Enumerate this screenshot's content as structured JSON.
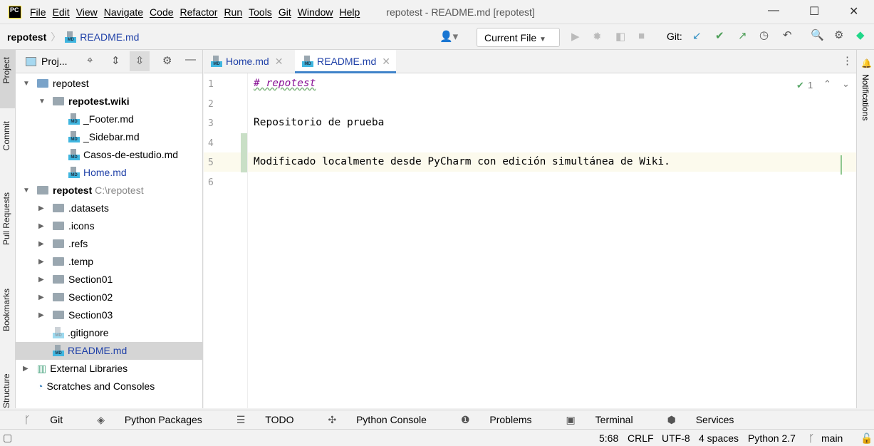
{
  "app": {
    "logo": "PC",
    "title": "repotest - README.md [repotest]"
  },
  "menu": [
    "File",
    "Edit",
    "View",
    "Navigate",
    "Code",
    "Refactor",
    "Run",
    "Tools",
    "Git",
    "Window",
    "Help"
  ],
  "breadcrumb": {
    "project": "repotest",
    "file": "README.md"
  },
  "toolbar": {
    "run_config": "Current File",
    "git_label": "Git:"
  },
  "project_panel": {
    "title": "Proj..."
  },
  "tree": [
    {
      "label": "repotest",
      "level": 0,
      "expanded": true,
      "type": "module"
    },
    {
      "label": "repotest.wiki",
      "level": 1,
      "expanded": true,
      "type": "folder",
      "bold": true
    },
    {
      "label": "_Footer.md",
      "level": 2,
      "type": "md"
    },
    {
      "label": "_Sidebar.md",
      "level": 2,
      "type": "md"
    },
    {
      "label": "Casos-de-estudio.md",
      "level": 2,
      "type": "md"
    },
    {
      "label": "Home.md",
      "level": 2,
      "type": "md",
      "blue": true
    },
    {
      "label": "repotest",
      "hint": "C:\\repotest",
      "level": 0,
      "expanded": true,
      "type": "folder",
      "bold": true
    },
    {
      "label": ".datasets",
      "level": 1,
      "expanded": false,
      "type": "folder"
    },
    {
      "label": ".icons",
      "level": 1,
      "expanded": false,
      "type": "folder"
    },
    {
      "label": ".refs",
      "level": 1,
      "expanded": false,
      "type": "folder"
    },
    {
      "label": ".temp",
      "level": 1,
      "expanded": false,
      "type": "folder"
    },
    {
      "label": "Section01",
      "level": 1,
      "expanded": false,
      "type": "folder"
    },
    {
      "label": "Section02",
      "level": 1,
      "expanded": false,
      "type": "folder"
    },
    {
      "label": "Section03",
      "level": 1,
      "expanded": false,
      "type": "folder"
    },
    {
      "label": ".gitignore",
      "level": 1,
      "type": "file"
    },
    {
      "label": "README.md",
      "level": 1,
      "type": "md",
      "blue": true,
      "selected": true
    },
    {
      "label": "External Libraries",
      "level": 0,
      "expanded": false,
      "type": "lib"
    },
    {
      "label": "Scratches and Consoles",
      "level": 0,
      "type": "scratch"
    }
  ],
  "editor_tabs": [
    {
      "label": "Home.md",
      "active": false
    },
    {
      "label": "README.md",
      "active": true
    }
  ],
  "editor": {
    "lines": [
      "# repotest",
      "",
      "Repositorio de prueba",
      "",
      "Modificado localmente desde PyCharm con edición simultánea de Wiki.",
      ""
    ],
    "inspection_count": "1"
  },
  "left_strip": [
    "Project",
    "Commit",
    "Pull Requests",
    "Bookmarks",
    "Structure"
  ],
  "right_strip": [
    "Notifications"
  ],
  "bottom_tools": [
    "Git",
    "Python Packages",
    "TODO",
    "Python Console",
    "Problems",
    "Terminal",
    "Services"
  ],
  "status": {
    "position": "5:68",
    "line_sep": "CRLF",
    "encoding": "UTF-8",
    "indent": "4 spaces",
    "interpreter": "Python 2.7",
    "branch": "main"
  }
}
